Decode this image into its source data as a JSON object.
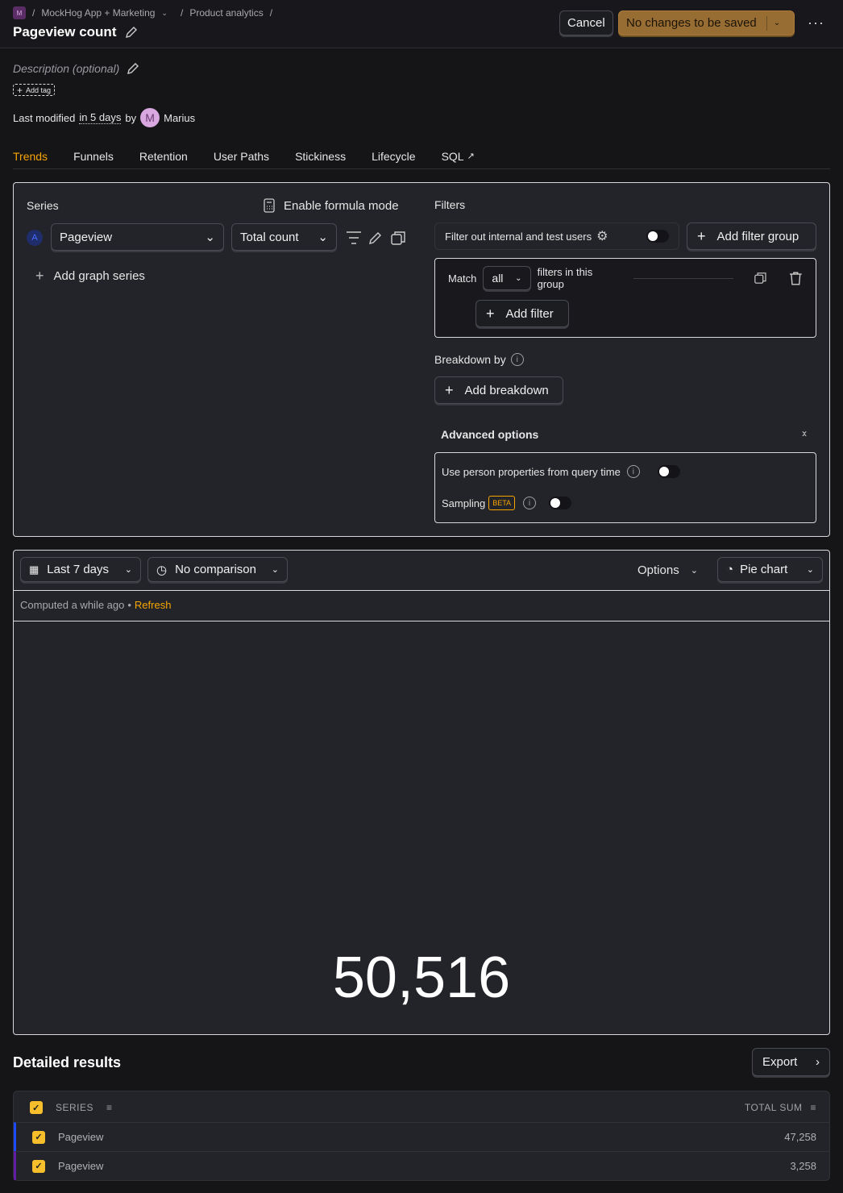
{
  "breadcrumb": {
    "logo": "M",
    "project": "MockHog App + Marketing",
    "section": "Product analytics"
  },
  "header": {
    "title": "Pageview count",
    "cancel": "Cancel",
    "save": "No changes to be saved"
  },
  "meta": {
    "description_placeholder": "Description (optional)",
    "add_tag": "Add tag",
    "modified_prefix": "Last modified",
    "modified_when": "in 5 days",
    "by": "by",
    "avatar": "M",
    "author": "Marius"
  },
  "tabs": [
    {
      "label": "Trends",
      "active": true
    },
    {
      "label": "Funnels"
    },
    {
      "label": "Retention"
    },
    {
      "label": "User Paths"
    },
    {
      "label": "Stickiness"
    },
    {
      "label": "Lifecycle"
    },
    {
      "label": "SQL"
    }
  ],
  "series": {
    "label": "Series",
    "formula": "Enable formula mode",
    "badge": "A",
    "event": "Pageview",
    "math": "Total count",
    "add": "Add graph series"
  },
  "filters": {
    "label": "Filters",
    "internal": "Filter out internal and test users",
    "add_group": "Add filter group",
    "match": "Match",
    "match_value": "all",
    "group_text": "filters in this group",
    "add_filter": "Add filter"
  },
  "breakdown": {
    "label": "Breakdown by",
    "add": "Add breakdown"
  },
  "advanced": {
    "label": "Advanced options",
    "person_props": "Use person properties from query time",
    "sampling": "Sampling",
    "beta": "BETA"
  },
  "toolbar": {
    "date": "Last 7 days",
    "comparison": "No comparison",
    "options": "Options",
    "chart_type": "Pie chart"
  },
  "status": {
    "computed": "Computed a while ago",
    "sep": "•",
    "refresh": "Refresh"
  },
  "result": {
    "total": "50,516"
  },
  "details": {
    "title": "Detailed results",
    "export": "Export",
    "col_series": "SERIES",
    "col_total": "TOTAL SUM",
    "rows": [
      {
        "name": "Pageview",
        "value": "47,258",
        "color": "#1d4aff"
      },
      {
        "name": "Pageview",
        "value": "3,258",
        "color": "#621da6"
      }
    ]
  },
  "colors": {
    "accent": "#f7a501",
    "save": "#986d33",
    "checkbox": "#f5be2a"
  }
}
